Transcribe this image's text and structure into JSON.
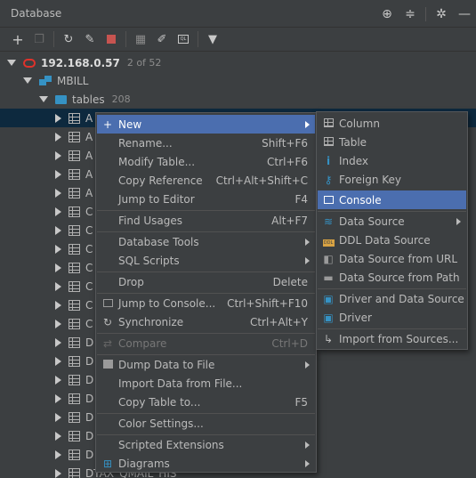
{
  "window": {
    "title": "Database"
  },
  "titlebar_icons": [
    "crosshair-icon",
    "collapse-icon",
    "gear-icon",
    "minimize-icon"
  ],
  "toolbar": {
    "buttons": [
      "add-icon",
      "duplicate-icon",
      "refresh-icon",
      "edit-icon",
      "stop-icon",
      "table-icon",
      "edit-data-icon",
      "console-icon",
      "filter-icon"
    ]
  },
  "tree": {
    "server": {
      "name": "192.168.0.57",
      "count": "2 of 52"
    },
    "schema": {
      "name": "MBILL"
    },
    "tables": {
      "name": "tables",
      "count": "208"
    },
    "rows": [
      "A",
      "A",
      "A",
      "A",
      "A",
      "C",
      "C",
      "C",
      "C",
      "C",
      "C",
      "C",
      "D",
      "D",
      "D",
      "D",
      "D",
      "D",
      "D",
      "D",
      "D",
      "D"
    ],
    "last_row": "DTAX_QMAIL_HIS"
  },
  "context_menu": {
    "items": [
      {
        "label": "New",
        "shortcut": "",
        "submenu": true
      },
      {
        "label": "Rename...",
        "shortcut": "Shift+F6"
      },
      {
        "label": "Modify Table...",
        "shortcut": "Ctrl+F6"
      },
      {
        "label": "Copy Reference",
        "shortcut": "Ctrl+Alt+Shift+C"
      },
      {
        "label": "Jump to Editor",
        "shortcut": "F4"
      },
      {
        "label": "Find Usages",
        "shortcut": "Alt+F7"
      },
      {
        "label": "Database Tools",
        "shortcut": "",
        "submenu": true
      },
      {
        "label": "SQL Scripts",
        "shortcut": "",
        "submenu": true
      },
      {
        "label": "Drop",
        "shortcut": "Delete"
      },
      {
        "label": "Jump to Console...",
        "shortcut": "Ctrl+Shift+F10"
      },
      {
        "label": "Synchronize",
        "shortcut": "Ctrl+Alt+Y"
      },
      {
        "label": "Compare",
        "shortcut": "Ctrl+D",
        "disabled": true
      },
      {
        "label": "Dump Data to File",
        "shortcut": "",
        "submenu": true
      },
      {
        "label": "Import Data from File...",
        "shortcut": ""
      },
      {
        "label": "Copy Table to...",
        "shortcut": "F5"
      },
      {
        "label": "Color Settings...",
        "shortcut": ""
      },
      {
        "label": "Scripted Extensions",
        "shortcut": "",
        "submenu": true
      },
      {
        "label": "Diagrams",
        "shortcut": "",
        "submenu": true
      }
    ]
  },
  "new_submenu": {
    "items": [
      {
        "label": "Column"
      },
      {
        "label": "Table"
      },
      {
        "label": "Index"
      },
      {
        "label": "Foreign Key"
      },
      {
        "label": "Console"
      },
      {
        "label": "Data Source",
        "submenu": true
      },
      {
        "label": "DDL Data Source"
      },
      {
        "label": "Data Source from URL"
      },
      {
        "label": "Data Source from Path"
      },
      {
        "label": "Driver and Data Source"
      },
      {
        "label": "Driver"
      },
      {
        "label": "Import from Sources..."
      }
    ]
  },
  "colors": {
    "highlight": "#4b6eaf",
    "background": "#3c3f41",
    "oracle_red": "#e0322b",
    "db_blue": "#3592c4"
  }
}
